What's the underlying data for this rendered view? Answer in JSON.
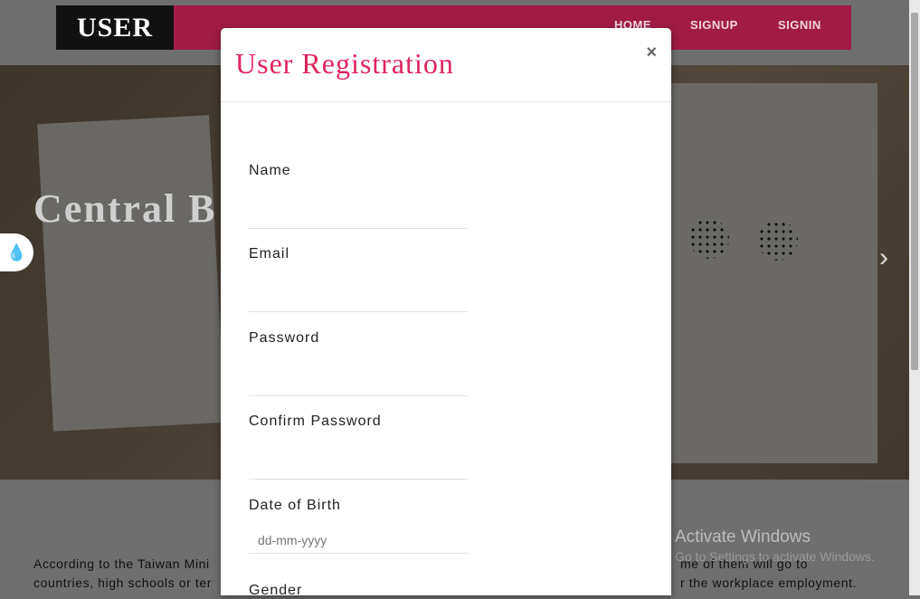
{
  "navbar": {
    "brand": "USER",
    "links": [
      "HOME",
      "SIGNUP",
      "SIGNIN"
    ]
  },
  "hero": {
    "title": "Central B"
  },
  "content": {
    "line1_left": "According to the Taiwan Mini",
    "line1_right": "me of them will go to",
    "line2_left": "countries, high schools or ter",
    "line2_right": "r the workplace employment."
  },
  "watermark": {
    "title": "Activate Windows",
    "subtitle": "Go to Settings to activate Windows."
  },
  "modal": {
    "title": "User Registration",
    "close_label": "×",
    "fields": {
      "name": {
        "label": "Name",
        "value": ""
      },
      "email": {
        "label": "Email",
        "value": ""
      },
      "password": {
        "label": "Password",
        "value": ""
      },
      "confirm_password": {
        "label": "Confirm Password",
        "value": ""
      },
      "dob": {
        "label": "Date of Birth",
        "placeholder": "dd-mm-yyyy"
      },
      "gender": {
        "label": "Gender"
      }
    }
  },
  "colors": {
    "accent": "#e0245e",
    "navbar": "#a01c45"
  },
  "icons": [
    "water-drop-icon",
    "chevron-right-icon",
    "close-icon"
  ]
}
